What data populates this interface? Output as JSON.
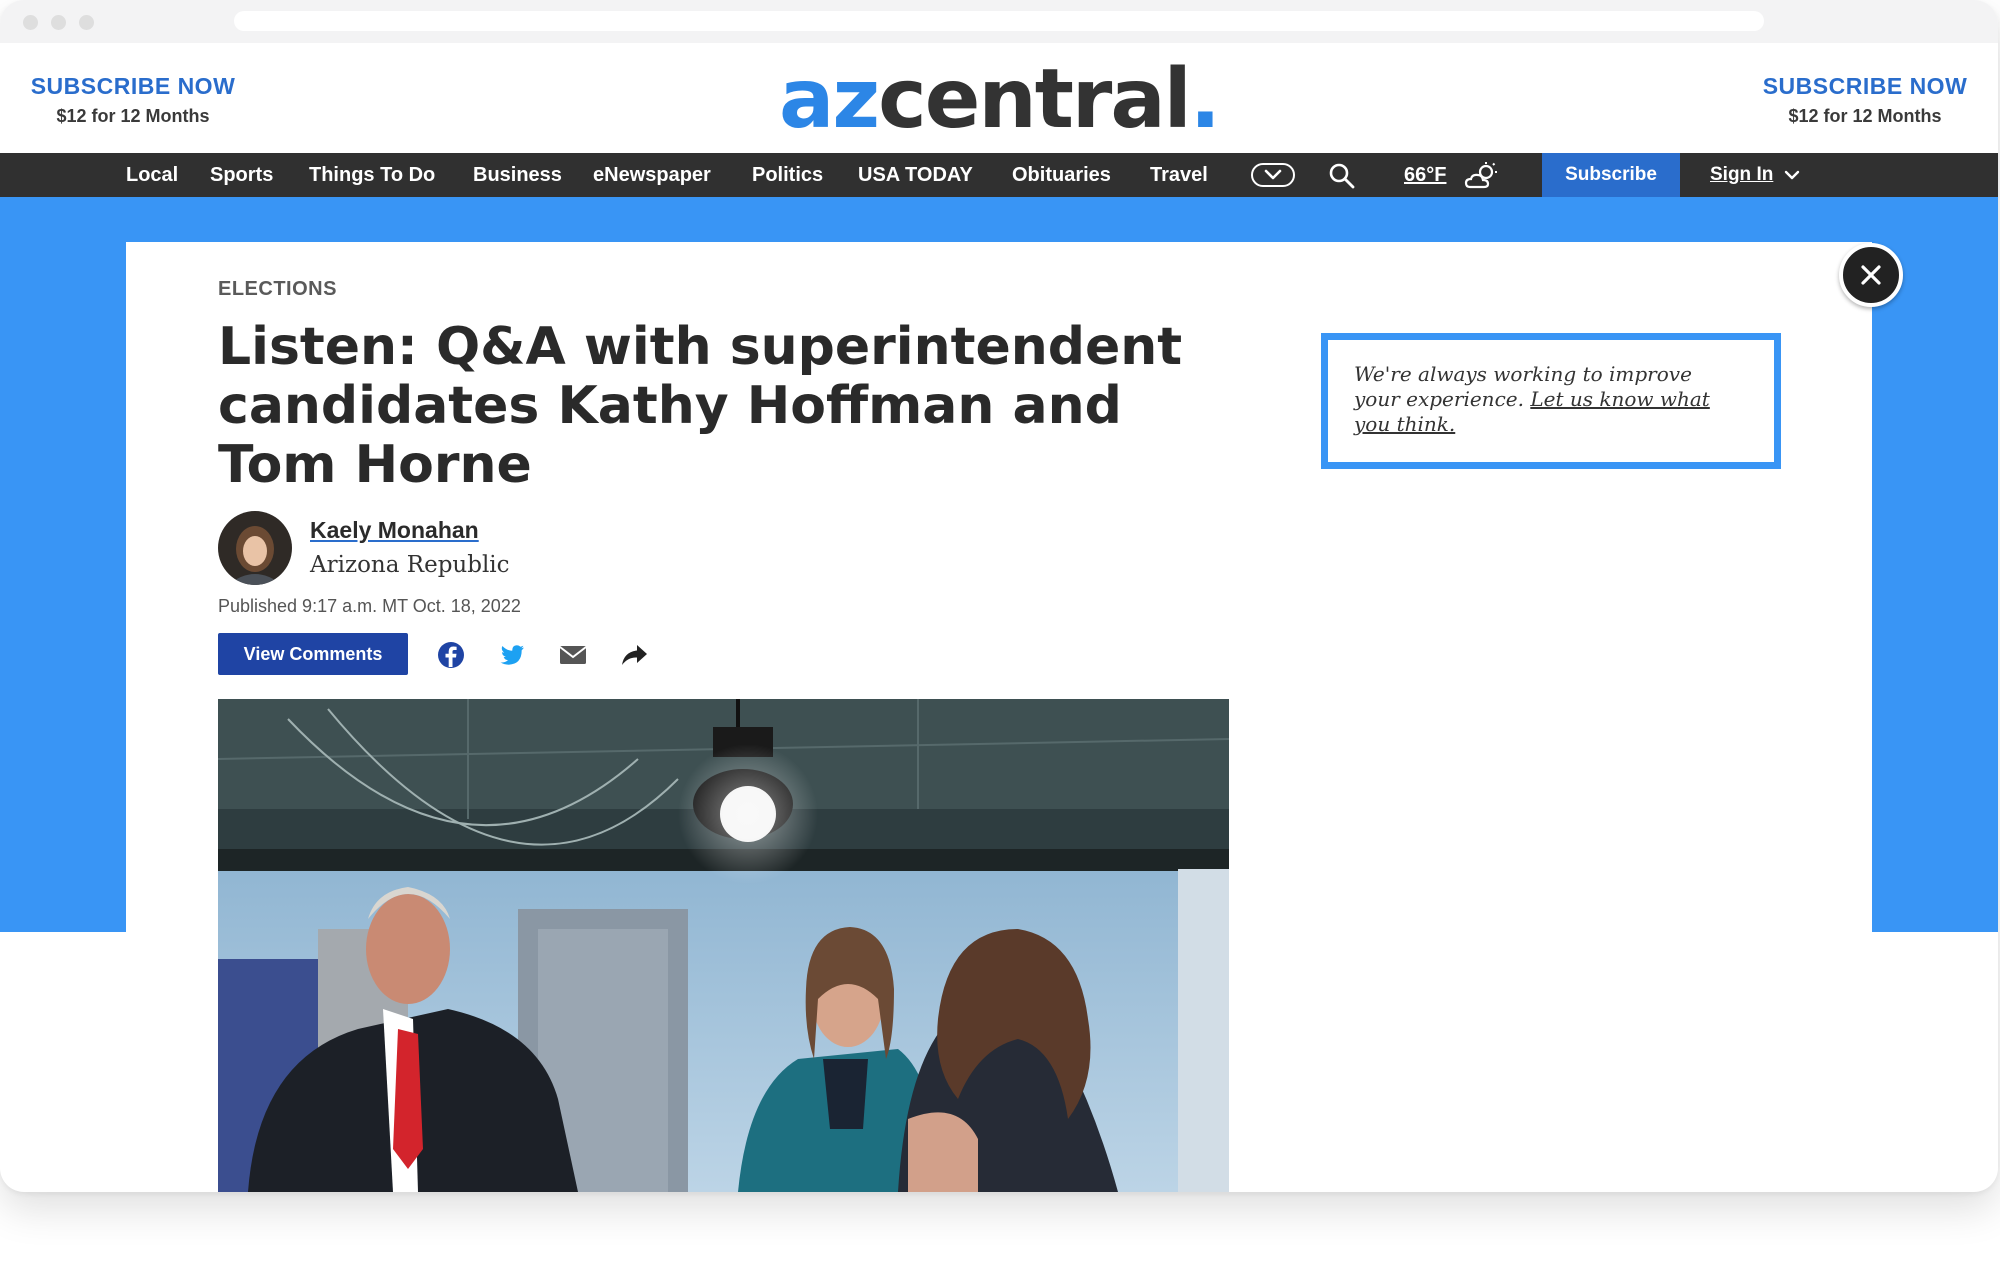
{
  "promo_left": {
    "title": "SUBSCRIBE NOW",
    "subtitle": "$12 for 12 Months"
  },
  "promo_right": {
    "title": "SUBSCRIBE NOW",
    "subtitle": "$12 for 12 Months"
  },
  "logo": {
    "az": "az",
    "central": "central",
    "dot": "."
  },
  "nav": {
    "items": [
      "Local",
      "Sports",
      "Things To Do",
      "Business",
      "eNewspaper",
      "Politics",
      "USA TODAY",
      "Obituaries",
      "Travel"
    ],
    "more_icon": "chevron-down-pill-icon",
    "search_icon": "search-icon",
    "weather": "66°F",
    "weather_icon": "partly-cloudy-icon",
    "subscribe": "Subscribe",
    "signin": "Sign In"
  },
  "article": {
    "section": "ELECTIONS",
    "headline": "Listen: Q&A with superintendent candidates Kathy Hoffman and Tom Horne",
    "author": "Kaely Monahan",
    "organization": "Arizona Republic",
    "published": "Published 9:17 a.m. MT Oct. 18, 2022",
    "comments_button": "View Comments",
    "share_icons": [
      "facebook-icon",
      "twitter-icon",
      "email-icon",
      "share-arrow-icon"
    ]
  },
  "feedback": {
    "text": "We're always working to improve your experience.",
    "link": "Let us know what you think."
  },
  "colors": {
    "accent": "#2a6dcc",
    "brand_blue": "#3995f5",
    "nav_bg": "#303030",
    "button_dark_blue": "#1f44a4"
  }
}
